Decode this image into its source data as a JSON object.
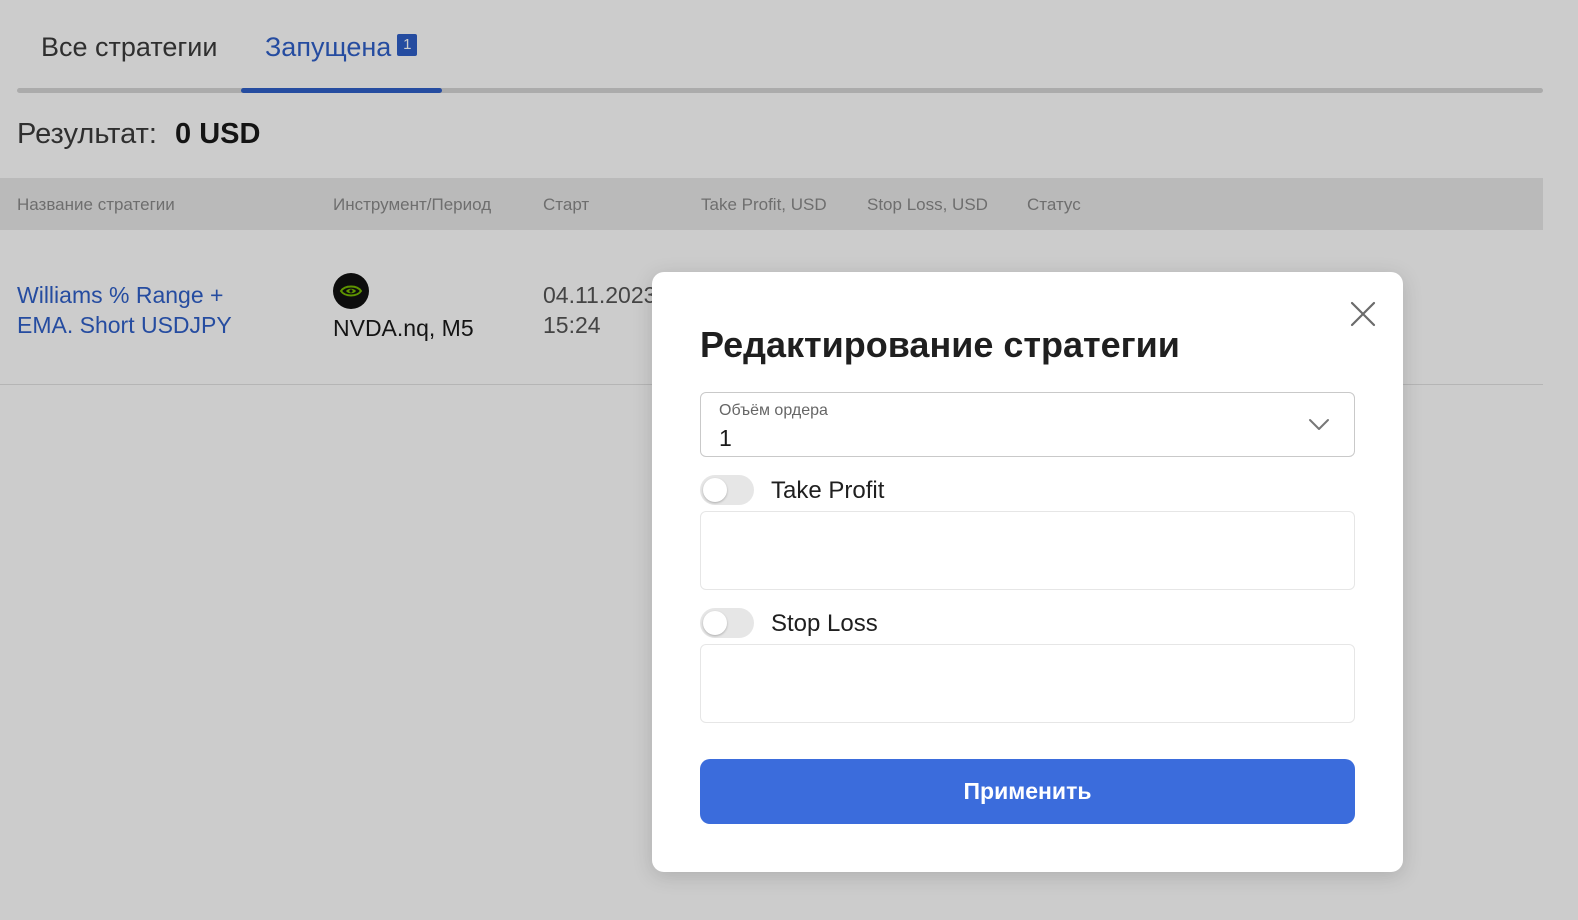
{
  "tabs": {
    "all_label": "Все стратегии",
    "running_label": "Запущена",
    "running_badge": "1"
  },
  "result": {
    "label": "Результат:",
    "value": "0 USD"
  },
  "table": {
    "headers": {
      "name": "Название стратегии",
      "instrument": "Инструмент/Период",
      "start": "Старт",
      "take_profit": "Take Profit, USD",
      "stop_loss": "Stop Loss, USD",
      "status": "Статус"
    },
    "rows": [
      {
        "name": "Williams % Range + EMA. Short USDJPY",
        "instrument": "NVDA.nq, M5",
        "instrument_icon": "nvidia-logo-icon",
        "start_date": "04.11.2023",
        "start_time": "15:24"
      }
    ]
  },
  "modal": {
    "title": "Редактирование стратегии",
    "order_volume": {
      "label": "Объём ордера",
      "value": "1"
    },
    "take_profit": {
      "label": "Take Profit",
      "enabled": false,
      "value": ""
    },
    "stop_loss": {
      "label": "Stop Loss",
      "enabled": false,
      "value": ""
    },
    "apply_label": "Применить"
  },
  "colors": {
    "accent": "#2f5fc9",
    "button": "#3b6cdc",
    "overlay": "rgba(0,0,0,0.2)"
  }
}
